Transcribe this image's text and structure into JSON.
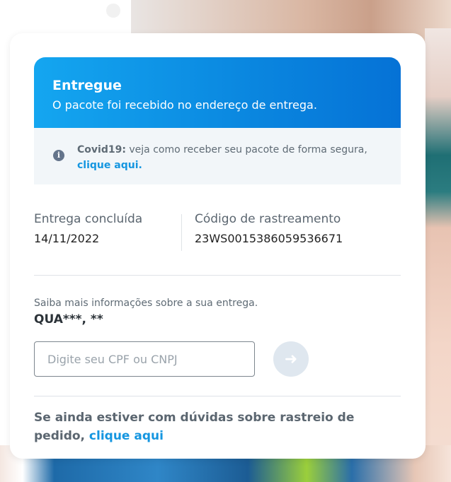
{
  "status": {
    "title": "Entregue",
    "description": "O pacote foi recebido no endereço de entrega."
  },
  "notice": {
    "icon": "info-icon",
    "label": "Covid19:",
    "text": " veja como receber seu pacote de forma segura,",
    "link": "clique aqui."
  },
  "delivery": {
    "concluded_label": "Entrega concluída",
    "concluded_date": "14/11/2022",
    "tracking_label": "Código de rastreamento",
    "tracking_code": "23WS0015386059536671"
  },
  "more_info": {
    "text": "Saiba mais informações sobre a sua entrega.",
    "receiver": "QUA***, **"
  },
  "document_input": {
    "placeholder": "Digite seu CPF ou CNPJ",
    "button_icon": "arrow-right-icon"
  },
  "footer": {
    "text": "Se ainda estiver com dúvidas sobre rastreio de pedido, ",
    "link": "clique aqui"
  },
  "colors": {
    "primary_blue": "#0a86df",
    "link_blue": "#1596e0",
    "notice_bg": "#f2f6f9"
  }
}
